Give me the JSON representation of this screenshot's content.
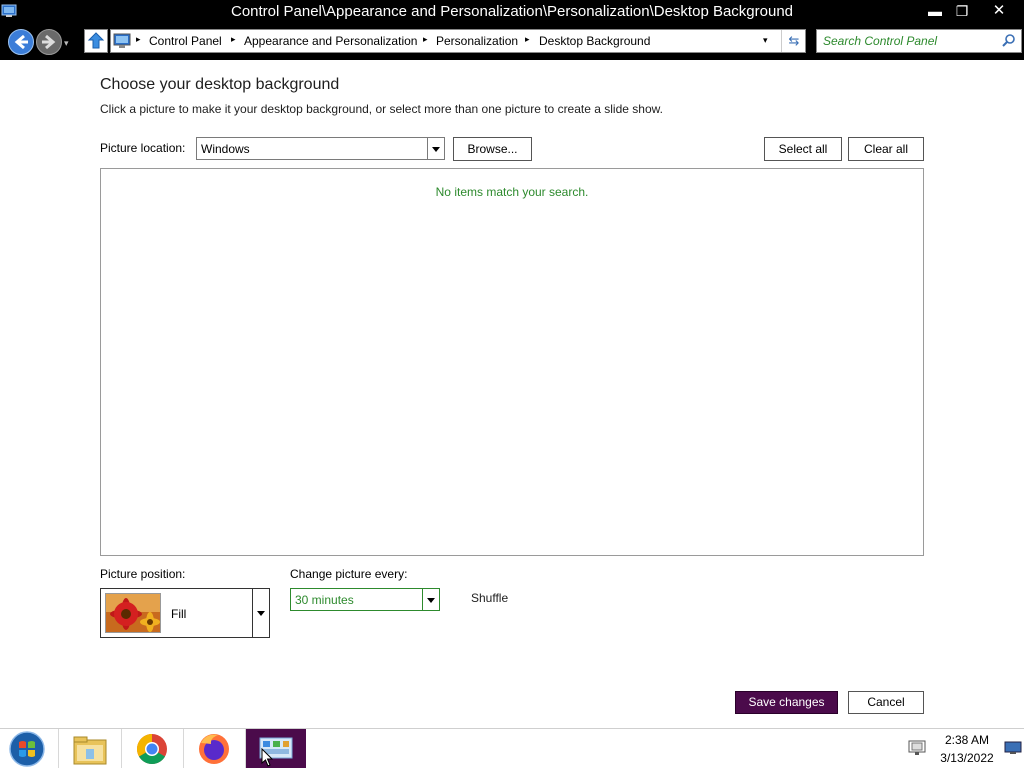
{
  "window": {
    "title": "Control Panel\\Appearance and Personalization\\Personalization\\Desktop Background",
    "minimize_glyph": "▬",
    "maximize_glyph": "❐",
    "close_glyph": "✕"
  },
  "address_bar": {
    "breadcrumbs": [
      "Control Panel",
      "Appearance and Personalization",
      "Personalization",
      "Desktop Background"
    ],
    "separator": "▸",
    "dropdown_glyph": "▾",
    "refresh_glyph": "⇆"
  },
  "search": {
    "placeholder": "Search Control Panel",
    "value": ""
  },
  "main": {
    "heading": "Choose your desktop background",
    "subtext": "Click a picture to make it your desktop background, or select more than one picture to create a slide show.",
    "picture_location_label": "Picture location:",
    "picture_location_value": "Windows",
    "browse_label": "Browse...",
    "select_all_label": "Select all",
    "clear_all_label": "Clear all",
    "empty_message": "No items match your search.",
    "picture_position_label": "Picture position:",
    "picture_position_value": "Fill",
    "change_picture_label": "Change picture every:",
    "change_picture_value": "30 minutes",
    "shuffle_label": "Shuffle",
    "save_label": "Save changes",
    "cancel_label": "Cancel"
  },
  "taskbar": {
    "items": [
      "start-button",
      "file-explorer",
      "chrome",
      "firefox",
      "control-panel"
    ],
    "active_item": "control-panel",
    "clock_time": "2:38 AM",
    "clock_date": "3/13/2022"
  },
  "colors": {
    "accent_purple": "#4b0b4b",
    "status_green": "#2d8a2d",
    "title_bar": "#000000"
  }
}
